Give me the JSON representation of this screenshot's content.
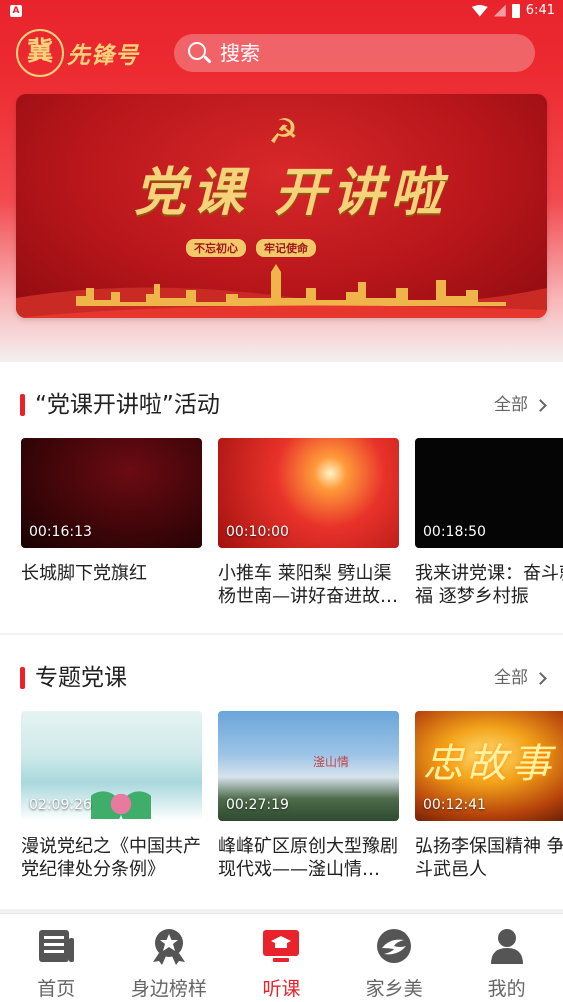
{
  "status_bar": {
    "time": "6:41",
    "notif": "A"
  },
  "header": {
    "logo_seal": "冀",
    "logo_text": "先锋号",
    "search_placeholder": "搜索"
  },
  "banner": {
    "title": "党课 开讲啦",
    "tags": [
      "不忘初心",
      "牢记使命"
    ]
  },
  "sections": [
    {
      "title": "“党课开讲啦”活动",
      "more": "全部",
      "videos": [
        {
          "duration": "00:16:13",
          "title": "长城脚下党旗红"
        },
        {
          "duration": "00:10:00",
          "title": "小推车 莱阳梨 劈山渠 杨世南—讲好奋进故…"
        },
        {
          "duration": "00:18:50",
          "title": "我来讲党课：奋斗就幸福 逐梦乡村振"
        }
      ]
    },
    {
      "title": "专题党课",
      "more": "全部",
      "videos": [
        {
          "duration": "02:09:26",
          "title": "漫说党纪之《中国共产党纪律处分条例》"
        },
        {
          "duration": "00:27:19",
          "title": "峰峰矿区原创大型豫剧现代戏——滏山情…",
          "thumb_text": "滏山情"
        },
        {
          "duration": "00:12:41",
          "title": "弘扬李保国精神 争奋斗武邑人",
          "thumb_text": "忠故事"
        }
      ]
    }
  ],
  "bottom_nav": [
    {
      "label": "首页",
      "icon": "news-icon",
      "active": false
    },
    {
      "label": "身边榜样",
      "icon": "medal-icon",
      "active": false
    },
    {
      "label": "听课",
      "icon": "lecture-screen-icon",
      "active": true
    },
    {
      "label": "家乡美",
      "icon": "hometown-icon",
      "active": false
    },
    {
      "label": "我的",
      "icon": "user-icon",
      "active": false
    }
  ],
  "colors": {
    "brand_red": "#e8232c",
    "gold": "#f6d27a"
  }
}
